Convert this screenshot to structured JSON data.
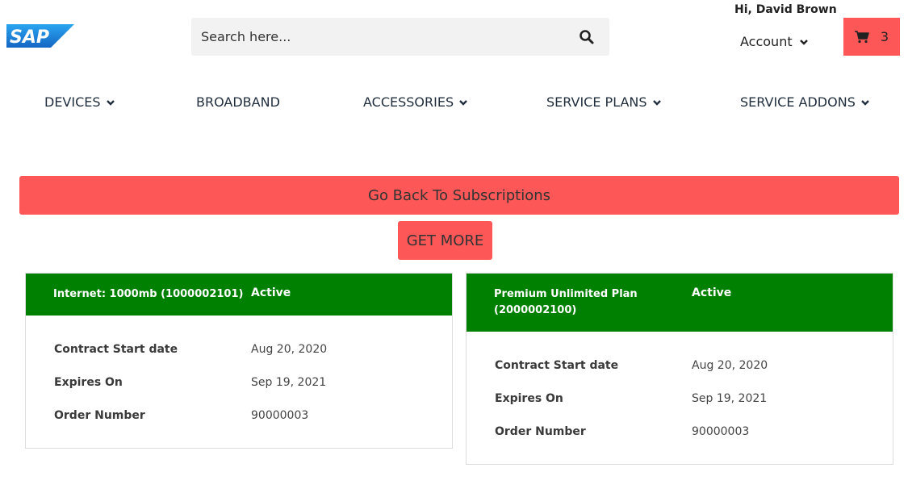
{
  "header": {
    "logo_text": "SAP",
    "search_placeholder": "Search here...",
    "greeting": "Hi, David Brown",
    "account_label": "Account",
    "cart_count": "3"
  },
  "nav": [
    {
      "label": "DEVICES",
      "has_dropdown": true
    },
    {
      "label": "BROADBAND",
      "has_dropdown": false
    },
    {
      "label": "ACCESSORIES",
      "has_dropdown": true
    },
    {
      "label": "SERVICE PLANS",
      "has_dropdown": true
    },
    {
      "label": "SERVICE ADDONS",
      "has_dropdown": true
    }
  ],
  "actions": {
    "back_label": "Go Back To Subscriptions",
    "more_label": "GET MORE"
  },
  "subscriptions": [
    {
      "title_line1": "Internet: 1000mb (1000002101)",
      "title_line2": "",
      "status": "Active",
      "fields": [
        {
          "label": "Contract Start date",
          "value": "Aug 20, 2020"
        },
        {
          "label": "Expires On",
          "value": "Sep 19, 2021"
        },
        {
          "label": "Order Number",
          "value": "90000003"
        }
      ]
    },
    {
      "title_line1": "Premium Unlimited Plan",
      "title_line2": "(2000002100)",
      "status": "Active",
      "fields": [
        {
          "label": "Contract Start date",
          "value": "Aug 20, 2020"
        },
        {
          "label": "Expires On",
          "value": "Sep 19, 2021"
        },
        {
          "label": "Order Number",
          "value": "90000003"
        }
      ]
    }
  ],
  "colors": {
    "accent": "#fd5857",
    "active_header": "#008000",
    "logo_blue": "#1a7bd4"
  },
  "icons": {
    "search": "search-icon",
    "cart": "cart-icon",
    "dropdown": "chevron-down-icon"
  }
}
